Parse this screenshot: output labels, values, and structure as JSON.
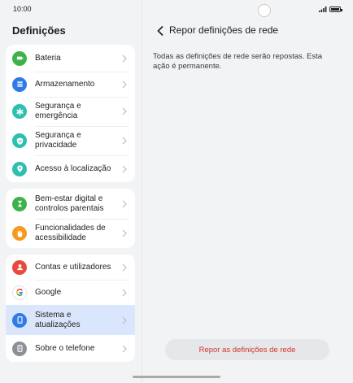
{
  "status": {
    "time": "10:00"
  },
  "sidebar": {
    "title": "Definições",
    "groups": [
      {
        "items": [
          {
            "label": "Bateria",
            "icon": "battery-icon",
            "color": "#3db34a"
          },
          {
            "label": "Armazenamento",
            "icon": "storage-icon",
            "color": "#2f7ae5"
          },
          {
            "label": "Segurança e emergência",
            "icon": "emergency-icon",
            "color": "#2dbfb0"
          },
          {
            "label": "Segurança e privacidade",
            "icon": "shield-icon",
            "color": "#2dbfb0"
          },
          {
            "label": "Acesso à localização",
            "icon": "location-icon",
            "color": "#2dbfb0"
          }
        ]
      },
      {
        "items": [
          {
            "label": "Bem-estar digital e controlos parentais",
            "icon": "hourglass-icon",
            "color": "#3db34a"
          },
          {
            "label": "Funcionalidades de acessibilidade",
            "icon": "hand-icon",
            "color": "#f39a1f"
          }
        ]
      },
      {
        "items": [
          {
            "label": "Contas e utilizadores",
            "icon": "user-icon",
            "color": "#e84b3c"
          },
          {
            "label": "Google",
            "icon": "google-icon",
            "color": "#ffffff"
          },
          {
            "label": "Sistema e atualizações",
            "icon": "phone-update-icon",
            "color": "#2f7ae5",
            "selected": true
          },
          {
            "label": "Sobre o telefone",
            "icon": "phone-info-icon",
            "color": "#8b8f96"
          }
        ]
      }
    ]
  },
  "detail": {
    "title": "Repor definições de rede",
    "description": "Todas as definições de rede serão repostas. Esta ação é permanente.",
    "reset_button": "Repor as definições de rede",
    "reset_color": "#d4342d"
  }
}
